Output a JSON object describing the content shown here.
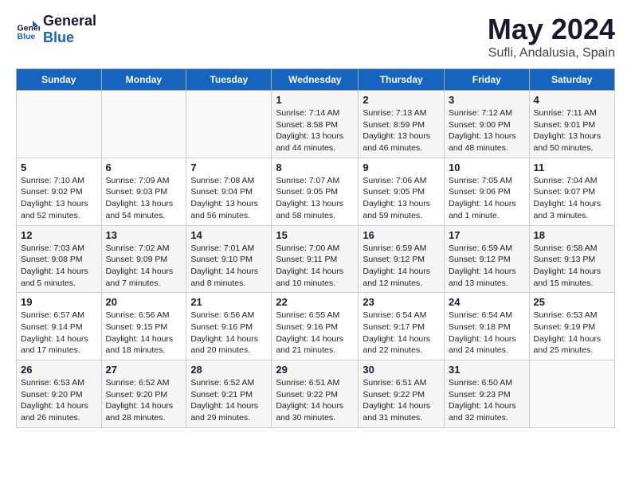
{
  "header": {
    "logo_general": "General",
    "logo_blue": "Blue",
    "title": "May 2024",
    "subtitle": "Sufli, Andalusia, Spain"
  },
  "days_of_week": [
    "Sunday",
    "Monday",
    "Tuesday",
    "Wednesday",
    "Thursday",
    "Friday",
    "Saturday"
  ],
  "weeks": [
    [
      {
        "day": "",
        "info": ""
      },
      {
        "day": "",
        "info": ""
      },
      {
        "day": "",
        "info": ""
      },
      {
        "day": "1",
        "info": "Sunrise: 7:14 AM\nSunset: 8:58 PM\nDaylight: 13 hours and 44 minutes."
      },
      {
        "day": "2",
        "info": "Sunrise: 7:13 AM\nSunset: 8:59 PM\nDaylight: 13 hours and 46 minutes."
      },
      {
        "day": "3",
        "info": "Sunrise: 7:12 AM\nSunset: 9:00 PM\nDaylight: 13 hours and 48 minutes."
      },
      {
        "day": "4",
        "info": "Sunrise: 7:11 AM\nSunset: 9:01 PM\nDaylight: 13 hours and 50 minutes."
      }
    ],
    [
      {
        "day": "5",
        "info": "Sunrise: 7:10 AM\nSunset: 9:02 PM\nDaylight: 13 hours and 52 minutes."
      },
      {
        "day": "6",
        "info": "Sunrise: 7:09 AM\nSunset: 9:03 PM\nDaylight: 13 hours and 54 minutes."
      },
      {
        "day": "7",
        "info": "Sunrise: 7:08 AM\nSunset: 9:04 PM\nDaylight: 13 hours and 56 minutes."
      },
      {
        "day": "8",
        "info": "Sunrise: 7:07 AM\nSunset: 9:05 PM\nDaylight: 13 hours and 58 minutes."
      },
      {
        "day": "9",
        "info": "Sunrise: 7:06 AM\nSunset: 9:05 PM\nDaylight: 13 hours and 59 minutes."
      },
      {
        "day": "10",
        "info": "Sunrise: 7:05 AM\nSunset: 9:06 PM\nDaylight: 14 hours and 1 minute."
      },
      {
        "day": "11",
        "info": "Sunrise: 7:04 AM\nSunset: 9:07 PM\nDaylight: 14 hours and 3 minutes."
      }
    ],
    [
      {
        "day": "12",
        "info": "Sunrise: 7:03 AM\nSunset: 9:08 PM\nDaylight: 14 hours and 5 minutes."
      },
      {
        "day": "13",
        "info": "Sunrise: 7:02 AM\nSunset: 9:09 PM\nDaylight: 14 hours and 7 minutes."
      },
      {
        "day": "14",
        "info": "Sunrise: 7:01 AM\nSunset: 9:10 PM\nDaylight: 14 hours and 8 minutes."
      },
      {
        "day": "15",
        "info": "Sunrise: 7:00 AM\nSunset: 9:11 PM\nDaylight: 14 hours and 10 minutes."
      },
      {
        "day": "16",
        "info": "Sunrise: 6:59 AM\nSunset: 9:12 PM\nDaylight: 14 hours and 12 minutes."
      },
      {
        "day": "17",
        "info": "Sunrise: 6:59 AM\nSunset: 9:12 PM\nDaylight: 14 hours and 13 minutes."
      },
      {
        "day": "18",
        "info": "Sunrise: 6:58 AM\nSunset: 9:13 PM\nDaylight: 14 hours and 15 minutes."
      }
    ],
    [
      {
        "day": "19",
        "info": "Sunrise: 6:57 AM\nSunset: 9:14 PM\nDaylight: 14 hours and 17 minutes."
      },
      {
        "day": "20",
        "info": "Sunrise: 6:56 AM\nSunset: 9:15 PM\nDaylight: 14 hours and 18 minutes."
      },
      {
        "day": "21",
        "info": "Sunrise: 6:56 AM\nSunset: 9:16 PM\nDaylight: 14 hours and 20 minutes."
      },
      {
        "day": "22",
        "info": "Sunrise: 6:55 AM\nSunset: 9:16 PM\nDaylight: 14 hours and 21 minutes."
      },
      {
        "day": "23",
        "info": "Sunrise: 6:54 AM\nSunset: 9:17 PM\nDaylight: 14 hours and 22 minutes."
      },
      {
        "day": "24",
        "info": "Sunrise: 6:54 AM\nSunset: 9:18 PM\nDaylight: 14 hours and 24 minutes."
      },
      {
        "day": "25",
        "info": "Sunrise: 6:53 AM\nSunset: 9:19 PM\nDaylight: 14 hours and 25 minutes."
      }
    ],
    [
      {
        "day": "26",
        "info": "Sunrise: 6:53 AM\nSunset: 9:20 PM\nDaylight: 14 hours and 26 minutes."
      },
      {
        "day": "27",
        "info": "Sunrise: 6:52 AM\nSunset: 9:20 PM\nDaylight: 14 hours and 28 minutes."
      },
      {
        "day": "28",
        "info": "Sunrise: 6:52 AM\nSunset: 9:21 PM\nDaylight: 14 hours and 29 minutes."
      },
      {
        "day": "29",
        "info": "Sunrise: 6:51 AM\nSunset: 9:22 PM\nDaylight: 14 hours and 30 minutes."
      },
      {
        "day": "30",
        "info": "Sunrise: 6:51 AM\nSunset: 9:22 PM\nDaylight: 14 hours and 31 minutes."
      },
      {
        "day": "31",
        "info": "Sunrise: 6:50 AM\nSunset: 9:23 PM\nDaylight: 14 hours and 32 minutes."
      },
      {
        "day": "",
        "info": ""
      }
    ]
  ]
}
